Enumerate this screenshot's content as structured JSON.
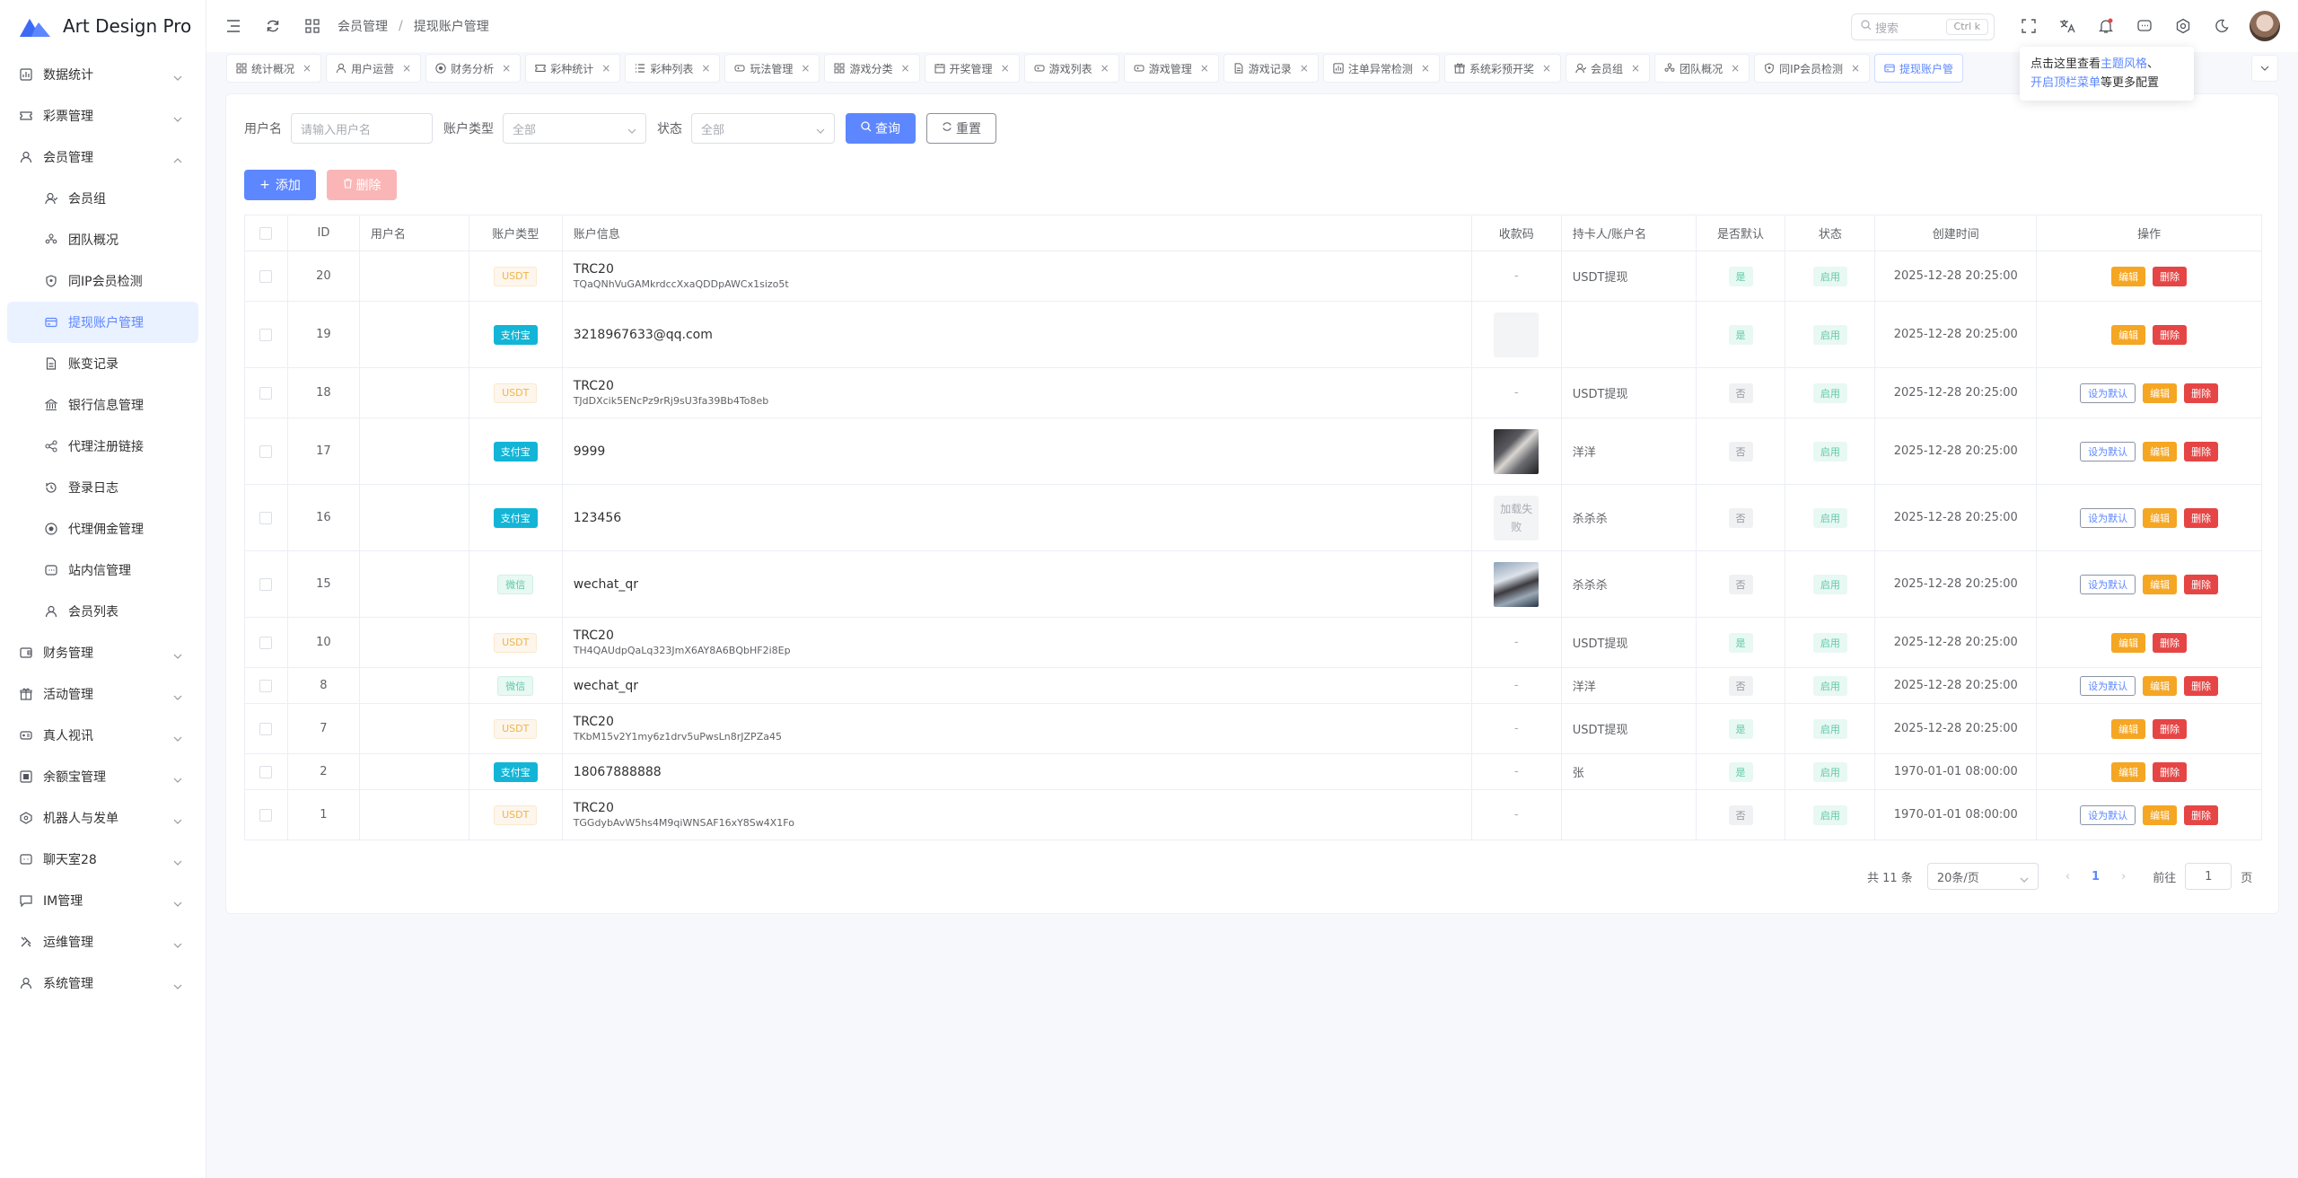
{
  "app": {
    "title": "Art Design Pro"
  },
  "colors": {
    "primary": "#5d87ff",
    "warning": "#f5a623",
    "danger": "#e64545",
    "success": "#5fc9a8",
    "alipay": "#13b5d6"
  },
  "sidebar": {
    "items": [
      {
        "label": "数据统计",
        "icon": "chart-icon"
      },
      {
        "label": "彩票管理",
        "icon": "ticket-icon"
      },
      {
        "label": "会员管理",
        "icon": "user-icon",
        "expanded": true
      }
    ],
    "sub_items": [
      {
        "label": "会员组",
        "icon": "user-group-icon"
      },
      {
        "label": "团队概况",
        "icon": "team-icon"
      },
      {
        "label": "同IP会员检测",
        "icon": "shield-icon"
      },
      {
        "label": "提现账户管理",
        "icon": "card-icon",
        "active": true
      },
      {
        "label": "账变记录",
        "icon": "document-icon"
      },
      {
        "label": "银行信息管理",
        "icon": "bank-icon"
      },
      {
        "label": "代理注册链接",
        "icon": "share-icon"
      },
      {
        "label": "登录日志",
        "icon": "history-icon"
      },
      {
        "label": "代理佣金管理",
        "icon": "coin-icon"
      },
      {
        "label": "站内信管理",
        "icon": "message-icon"
      },
      {
        "label": "会员列表",
        "icon": "user-icon"
      }
    ],
    "bottom_items": [
      {
        "label": "财务管理",
        "icon": "finance-icon"
      },
      {
        "label": "活动管理",
        "icon": "gift-icon"
      },
      {
        "label": "真人视讯",
        "icon": "video-icon"
      },
      {
        "label": "余额宝管理",
        "icon": "safe-icon"
      },
      {
        "label": "机器人与发单",
        "icon": "robot-icon"
      },
      {
        "label": "聊天室28",
        "icon": "chat-icon"
      },
      {
        "label": "IM管理",
        "icon": "im-icon"
      },
      {
        "label": "运维管理",
        "icon": "tools-icon"
      },
      {
        "label": "系统管理",
        "icon": "user-icon"
      }
    ]
  },
  "header": {
    "breadcrumb": [
      "会员管理",
      "提现账户管理"
    ],
    "search_placeholder": "搜索",
    "search_kbd": "Ctrl k"
  },
  "tabs": [
    {
      "label": "统计概况",
      "icon": "grid-icon"
    },
    {
      "label": "用户运营",
      "icon": "user-icon"
    },
    {
      "label": "财务分析",
      "icon": "coin-icon"
    },
    {
      "label": "彩种统计",
      "icon": "ticket-icon"
    },
    {
      "label": "彩种列表",
      "icon": "list-icon"
    },
    {
      "label": "玩法管理",
      "icon": "game-icon"
    },
    {
      "label": "游戏分类",
      "icon": "grid-icon"
    },
    {
      "label": "开奖管理",
      "icon": "calendar-icon"
    },
    {
      "label": "游戏列表",
      "icon": "game-icon"
    },
    {
      "label": "游戏管理",
      "icon": "game-icon"
    },
    {
      "label": "游戏记录",
      "icon": "document-icon"
    },
    {
      "label": "注单异常检测",
      "icon": "chart-icon"
    },
    {
      "label": "系统彩预开奖",
      "icon": "gift-icon"
    },
    {
      "label": "会员组",
      "icon": "user-group-icon"
    },
    {
      "label": "团队概况",
      "icon": "team-icon"
    },
    {
      "label": "同IP会员检测",
      "icon": "shield-icon"
    },
    {
      "label": "提现账户管",
      "icon": "card-icon",
      "active": true
    }
  ],
  "tooltip": {
    "line1_prefix": "点击这里查看",
    "line1_link": "主题风格",
    "line1_suffix": "、",
    "line2_link": "开启顶栏菜单",
    "line2_suffix": "等更多配置"
  },
  "filters": {
    "username_label": "用户名",
    "username_placeholder": "请输入用户名",
    "type_label": "账户类型",
    "type_value": "全部",
    "status_label": "状态",
    "status_value": "全部",
    "search_btn": "查询",
    "reset_btn": "重置"
  },
  "actions": {
    "add_btn": "添加",
    "delete_btn": "删除"
  },
  "table": {
    "headers": [
      "ID",
      "用户名",
      "账户类型",
      "账户信息",
      "收款码",
      "持卡人/账户名",
      "是否默认",
      "状态",
      "创建时间",
      "操作"
    ],
    "op_labels": {
      "set_default": "设为默认",
      "edit": "编辑",
      "delete": "删除"
    },
    "rows": [
      {
        "id": "20",
        "user": "",
        "type": "USDT",
        "info_main": "TRC20",
        "info_sub": "TQaQNhVuGAMkrdccXxaQDDpAWCx1sizo5t",
        "qr": "-",
        "holder": "USDT提现",
        "is_default": "是",
        "status": "启用",
        "created": "2025-12-28 20:25:00",
        "show_set_default": false
      },
      {
        "id": "19",
        "user": "",
        "type": "支付宝",
        "info_main": "3218967633@qq.com",
        "info_sub": "",
        "qr": "placeholder",
        "holder": "",
        "is_default": "是",
        "status": "启用",
        "created": "2025-12-28 20:25:00",
        "show_set_default": false
      },
      {
        "id": "18",
        "user": "",
        "type": "USDT",
        "info_main": "TRC20",
        "info_sub": "TJdDXcik5ENcPz9rRj9sU3fa39Bb4To8eb",
        "qr": "-",
        "holder": "USDT提现",
        "is_default": "否",
        "status": "启用",
        "created": "2025-12-28 20:25:00",
        "show_set_default": true
      },
      {
        "id": "17",
        "user": "",
        "type": "支付宝",
        "info_main": "9999",
        "info_sub": "",
        "qr": "image",
        "holder": "洋洋",
        "is_default": "否",
        "status": "启用",
        "created": "2025-12-28 20:25:00",
        "show_set_default": true
      },
      {
        "id": "16",
        "user": "",
        "type": "支付宝",
        "info_main": "123456",
        "info_sub": "",
        "qr": "加载失败",
        "holder": "杀杀杀",
        "is_default": "否",
        "status": "启用",
        "created": "2025-12-28 20:25:00",
        "show_set_default": true
      },
      {
        "id": "15",
        "user": "",
        "type": "微信",
        "info_main": "wechat_qr",
        "info_sub": "",
        "qr": "image2",
        "holder": "杀杀杀",
        "is_default": "否",
        "status": "启用",
        "created": "2025-12-28 20:25:00",
        "show_set_default": true
      },
      {
        "id": "10",
        "user": "",
        "type": "USDT",
        "info_main": "TRC20",
        "info_sub": "TH4QAUdpQaLq323JmX6AY8A6BQbHF2i8Ep",
        "qr": "-",
        "holder": "USDT提现",
        "is_default": "是",
        "status": "启用",
        "created": "2025-12-28 20:25:00",
        "show_set_default": false
      },
      {
        "id": "8",
        "user": "",
        "type": "微信",
        "info_main": "wechat_qr",
        "info_sub": "",
        "qr": "-",
        "holder": "洋洋",
        "is_default": "否",
        "status": "启用",
        "created": "2025-12-28 20:25:00",
        "show_set_default": true
      },
      {
        "id": "7",
        "user": "",
        "type": "USDT",
        "info_main": "TRC20",
        "info_sub": "TKbM15v2Y1my6z1drv5uPwsLn8rJZPZa45",
        "qr": "-",
        "holder": "USDT提现",
        "is_default": "是",
        "status": "启用",
        "created": "2025-12-28 20:25:00",
        "show_set_default": false
      },
      {
        "id": "2",
        "user": "",
        "type": "支付宝",
        "info_main": "18067888888",
        "info_sub": "",
        "qr": "-",
        "holder": "张",
        "is_default": "是",
        "status": "启用",
        "created": "1970-01-01 08:00:00",
        "show_set_default": false
      },
      {
        "id": "1",
        "user": "",
        "type": "USDT",
        "info_main": "TRC20",
        "info_sub": "TGGdybAvW5hs4M9qiWNSAF16xY8Sw4X1Fo",
        "qr": "-",
        "holder": "",
        "is_default": "否",
        "status": "启用",
        "created": "1970-01-01 08:00:00",
        "show_set_default": true
      }
    ]
  },
  "pagination": {
    "total": "共 11 条",
    "page_size": "20条/页",
    "current": "1",
    "goto_label": "前往",
    "goto_value": "1",
    "page_suffix": "页"
  }
}
